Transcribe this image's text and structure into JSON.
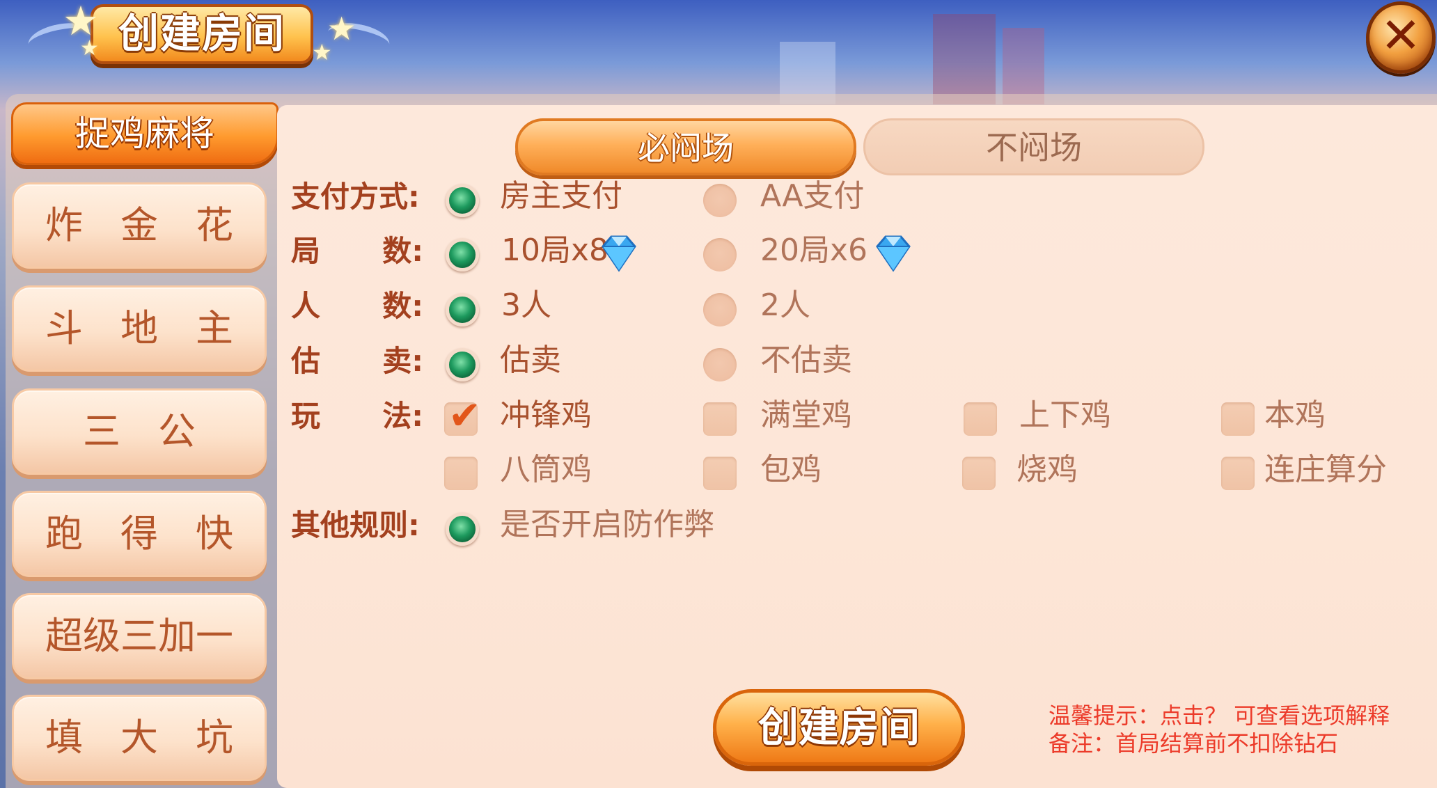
{
  "header": {
    "title": "创建房间"
  },
  "sidebar": {
    "items": [
      {
        "label": "捉鸡麻将",
        "active": true
      },
      {
        "label": "炸　金　花",
        "active": false
      },
      {
        "label": "斗　地　主",
        "active": false
      },
      {
        "label": "三　公",
        "active": false
      },
      {
        "label": "跑　得　快",
        "active": false
      },
      {
        "label": "超级三加一",
        "active": false
      },
      {
        "label": "填　大　坑",
        "active": false
      }
    ]
  },
  "mode_tabs": [
    {
      "label": "必闷场",
      "active": true
    },
    {
      "label": "不闷场",
      "active": false
    }
  ],
  "rows": {
    "payment": {
      "label": "支付方式:",
      "options": [
        {
          "text": "房主支付",
          "selected": true
        },
        {
          "text": "AA支付",
          "selected": false
        }
      ]
    },
    "rounds": {
      "label_a": "局",
      "label_b": "数:",
      "options": [
        {
          "text": "10局x8",
          "selected": true,
          "icon": "diamond-icon"
        },
        {
          "text": "20局x6",
          "selected": false,
          "icon": "diamond-icon"
        }
      ]
    },
    "players": {
      "label_a": "人",
      "label_b": "数:",
      "options": [
        {
          "text": "3人",
          "selected": true
        },
        {
          "text": "2人",
          "selected": false
        }
      ]
    },
    "gusell": {
      "label_a": "估",
      "label_b": "卖:",
      "options": [
        {
          "text": "估卖",
          "selected": true
        },
        {
          "text": "不估卖",
          "selected": false
        }
      ]
    },
    "play": {
      "label_a": "玩",
      "label_b": "法:",
      "options": [
        {
          "text": "冲锋鸡",
          "checked": true
        },
        {
          "text": "满堂鸡",
          "checked": false
        },
        {
          "text": "上下鸡",
          "checked": false
        },
        {
          "text": "本鸡",
          "checked": false
        },
        {
          "text": "八筒鸡",
          "checked": false
        },
        {
          "text": "包鸡",
          "checked": false
        },
        {
          "text": "烧鸡",
          "checked": false
        },
        {
          "text": "连庄算分",
          "checked": false
        }
      ]
    },
    "other": {
      "label": "其他规则:",
      "options": [
        {
          "text": "是否开启防作弊",
          "selected": true
        }
      ]
    }
  },
  "create_button": {
    "label": "创建房间"
  },
  "tips": {
    "hint": "温馨提示：点击？ 可查看选项解释",
    "note": "备注：首局结算前不扣除钻石"
  },
  "colors": {
    "accent_orange": "#f08a2a",
    "label_brown": "#a3401e",
    "selected_green": "#1d9a5e",
    "tip_red": "#ec3b2a"
  }
}
